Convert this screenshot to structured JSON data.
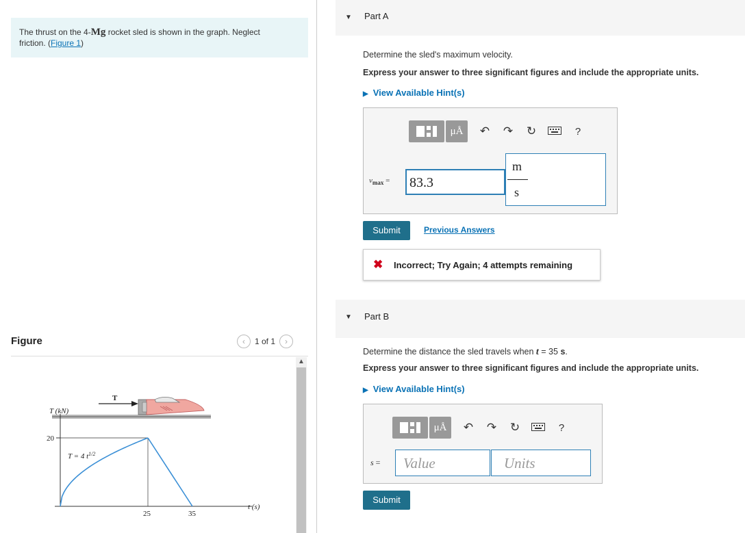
{
  "problem": {
    "text_a": "The thrust on the 4-",
    "mg": "Mg",
    "text_b": " rocket sled is shown in the graph. Neglect",
    "text_c": "friction. (",
    "figure_link": "Figure 1",
    "text_d": ")"
  },
  "figure": {
    "title": "Figure",
    "pager": "1 of 1",
    "prev_icon": "chevron-left-icon",
    "next_icon": "chevron-right-icon",
    "labels": {
      "thrust_arrow": "T",
      "y_axis": "T (kN)",
      "y_tick": "20",
      "equation": "T = 4 t",
      "equation_exp": "1/2",
      "x_tick_1": "25",
      "x_tick_2": "35",
      "x_axis": "t (s)"
    }
  },
  "partA": {
    "label": "Part A",
    "question": "Determine the sled's maximum velocity.",
    "instruction": "Express your answer to three significant figures and include the appropriate units.",
    "hint": "View Available Hint(s)",
    "toolbar": {
      "mu": "μÅ",
      "help": "?"
    },
    "var_main": "v",
    "var_sub": "max",
    "equals": "=",
    "value": "83.3",
    "units_num": "m",
    "units_den": "s",
    "submit": "Submit",
    "previous": "Previous Answers",
    "feedback": "Incorrect; Try Again; 4 attempts remaining"
  },
  "partB": {
    "label": "Part B",
    "question_a": "Determine the distance the sled travels when ",
    "question_var": "t",
    "question_b": " = 35 ",
    "question_unit": "s",
    "question_c": ".",
    "instruction": "Express your answer to three significant figures and include the appropriate units.",
    "hint": "View Available Hint(s)",
    "toolbar": {
      "mu": "μÅ",
      "help": "?"
    },
    "var": "s",
    "equals": "=",
    "value_placeholder": "Value",
    "units_placeholder": "Units",
    "submit": "Submit"
  }
}
